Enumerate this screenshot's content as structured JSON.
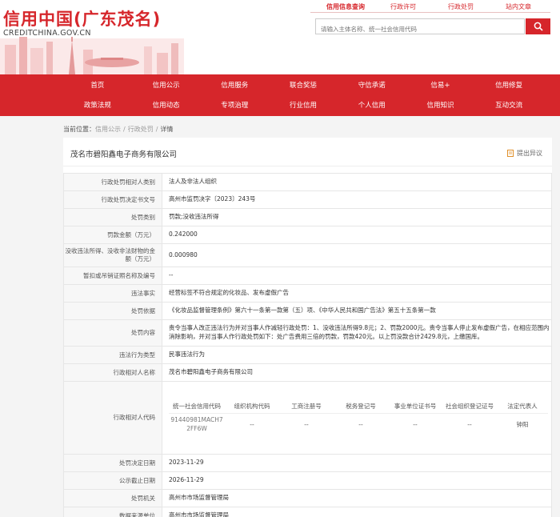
{
  "header": {
    "title": "信用中国(广东茂名)",
    "subtitle": "CREDITCHINA.GOV.CN",
    "top_nav": [
      "信用信息查询",
      "行政许可",
      "行政处罚",
      "站内文章"
    ],
    "search_placeholder": "请输入主体名称、统一社会信用代码"
  },
  "nav": {
    "row1": [
      "首页",
      "信用公示",
      "信用服务",
      "联合奖惩",
      "守信承诺",
      "信易+",
      "信用修复"
    ],
    "row2": [
      "政策法规",
      "信用动态",
      "专项治理",
      "行业信用",
      "个人信用",
      "信用知识",
      "互动交流"
    ]
  },
  "breadcrumb": {
    "label": "当前位置：",
    "items": [
      "信用公示",
      "行政处罚",
      "详情"
    ]
  },
  "record": {
    "company": "茂名市碧阳鑫电子商务有限公司",
    "objection_label": "提出异议",
    "rows": [
      {
        "label": "行政处罚相对人类别",
        "value": "法人及非法人组织"
      },
      {
        "label": "行政处罚决定书文号",
        "value": "高州市监罚决字〔2023〕243号"
      },
      {
        "label": "处罚类别",
        "value": "罚款;没收违法所得"
      },
      {
        "label": "罚款金额（万元）",
        "value": "0.242000"
      },
      {
        "label": "没收违法所得、没收非法财物的金额（万元）",
        "value": "0.000980"
      },
      {
        "label": "暂扣或吊销证照名称及编号",
        "value": "--"
      },
      {
        "label": "违法事实",
        "value": "经营标签不符合规定的化妆品、发布虚假广告"
      },
      {
        "label": "处罚依据",
        "value": "《化妆品监督管理条例》第六十一条第一款第（五）项、《中华人民共和国广告法》第五十五条第一款"
      },
      {
        "label": "处罚内容",
        "value": "责令当事人改正违法行为并对当事人作减轻行政处罚：1、没收违法所得9.8元；2、罚款2000元。责令当事人停止发布虚假广告，在相应范围内消除影响，并对当事人作行政处罚如下：处广告费用三倍的罚款，罚款420元。以上罚没款合计2429.8元，上缴国库。"
      },
      {
        "label": "违法行为类型",
        "value": "民事违法行为"
      },
      {
        "label": "行政相对人名称",
        "value": "茂名市碧阳鑫电子商务有限公司"
      }
    ],
    "codes_label": "行政相对人代码",
    "codes": {
      "headers": [
        "统一社会信用代码",
        "组织机构代码",
        "工商注册号",
        "税务登记号",
        "事业单位证书号",
        "社会组织登记证号",
        "法定代表人"
      ],
      "values": [
        "91440981MACH72FF6W",
        "--",
        "--",
        "--",
        "--",
        "--",
        "钟阳"
      ]
    },
    "rows_after": [
      {
        "label": "处罚决定日期",
        "value": "2023-11-29"
      },
      {
        "label": "公示截止日期",
        "value": "2026-11-29"
      },
      {
        "label": "处罚机关",
        "value": "高州市市场监督管理局"
      },
      {
        "label": "数据来源单位",
        "value": "高州市市场监督管理局"
      }
    ]
  },
  "colors": {
    "brand_red": "#d6262b"
  }
}
